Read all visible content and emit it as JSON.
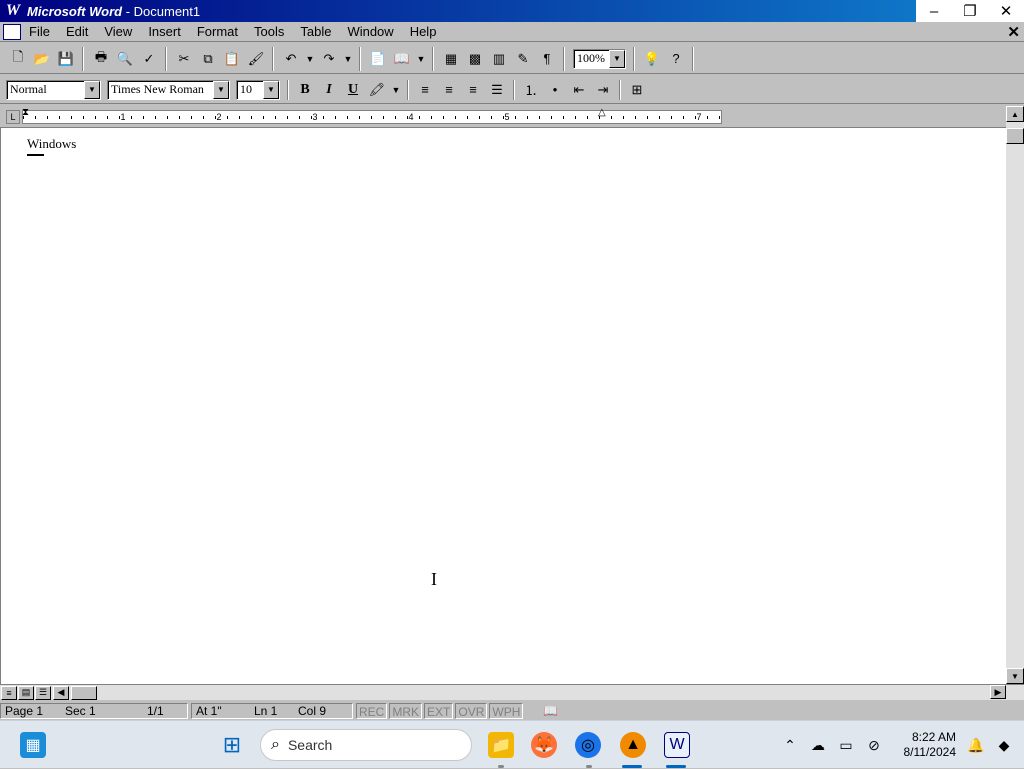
{
  "window": {
    "app_name": "Microsoft Word",
    "title_suffix": " - Document1",
    "minimize": "–",
    "restore": "❐",
    "close": "✕"
  },
  "menu": {
    "items": [
      "File",
      "Edit",
      "View",
      "Insert",
      "Format",
      "Tools",
      "Table",
      "Window",
      "Help"
    ],
    "doc_close": "✕"
  },
  "standard_toolbar": {
    "zoom": "100%"
  },
  "formatting_toolbar": {
    "style": "Normal",
    "font": "Times New Roman",
    "size": "10",
    "bold": "B",
    "italic": "I",
    "underline": "U"
  },
  "ruler": {
    "numbers": [
      "1",
      "2",
      "3",
      "4",
      "5",
      "7"
    ]
  },
  "document": {
    "text": "Windows"
  },
  "statusbar": {
    "page": "Page 1",
    "section": "Sec 1",
    "page_count": "1/1",
    "at": "At 1\"",
    "line": "Ln 1",
    "col": "Col 9",
    "rec": "REC",
    "mrk": "MRK",
    "ext": "EXT",
    "ovr": "OVR",
    "wph": "WPH"
  },
  "taskbar": {
    "search_placeholder": "Search",
    "time": "8:22 AM",
    "date": "8/11/2024",
    "accent": "#0067c0"
  }
}
